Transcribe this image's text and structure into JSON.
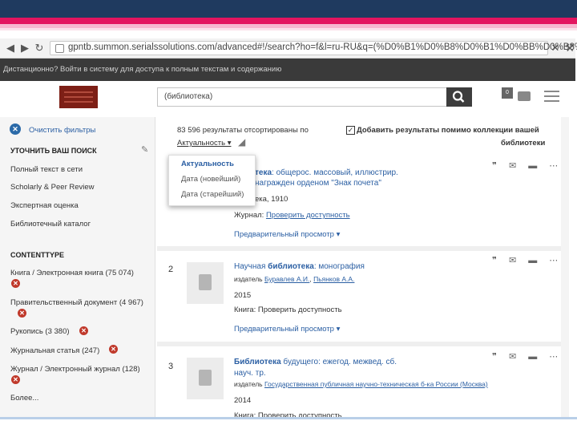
{
  "browser": {
    "url": "gpntb.summon.serialssolutions.com/advanced#!/search?ho=f&l=ru-RU&q=(%D0%B1%D0%B8%D0%B1%D0%BB%D0%B8%D0%"
  },
  "notice": "Дистанционно? Войти в систему для доступа к полным текстам и содержанию",
  "search": {
    "query": "(библиотека)"
  },
  "header": {
    "badge_count": "0"
  },
  "sidebar": {
    "clear": "Очистить фильтры",
    "refine": "УТОЧНИТЬ ВАШ ПОИСК",
    "filters": [
      "Полный текст в сети",
      "Scholarly & Peer Review",
      "Экспертная оценка",
      "Библиотечный каталог"
    ],
    "content_type_title": "CONTENTTYPE",
    "content_types": [
      "Книга / Электронная книга (75 074)",
      "Правительственный документ (4 967)",
      "Рукопись (3 380)",
      "Журнальная статья (247)",
      "Журнал / Электронный журнал (128)"
    ],
    "more": "Более..."
  },
  "results_header": {
    "count_text": "83 596 результаты отсортированы по",
    "sort_selected": "Актуальность ▾",
    "add_results": "Добавить результаты помимо коллекции вашей",
    "add_results_2": "библиотеки"
  },
  "sort_menu": [
    "Актуальность",
    "Дата (новейший)",
    "Дата (старейший)"
  ],
  "results": [
    {
      "title_bold": "тека",
      "title_rest": ": общерос. массовый, иллюстрир.",
      "line2": "награжден орденом \"Знак почета\"",
      "line3": "ека, 1910",
      "journal_label": "Журнал:",
      "journal_link": "Проверить доступность",
      "preview": "Предварительный просмотр ▾"
    },
    {
      "num": "2",
      "title_pre": "Научная ",
      "title_bold": "библиотека",
      "title_rest": ": монография",
      "publisher_label": "издатель",
      "authors": [
        "Буравлев А.И.",
        "Пьянков А.А."
      ],
      "year": "2015",
      "book_label": "Книга: Проверить доступность",
      "preview": "Предварительный просмотр ▾"
    },
    {
      "num": "3",
      "title_bold": "Библиотека",
      "title_rest": " будущего: ежегод. межвед. сб.",
      "title_line2": "науч. тр.",
      "publisher_label": "издатель",
      "publisher_link": "Государственная публичная научно-техническая б-ка России (Москва)",
      "year": "2014",
      "book_label": "Книга: Проверить доступность"
    }
  ],
  "actions": "❞ ✉ ▬ ⋯"
}
